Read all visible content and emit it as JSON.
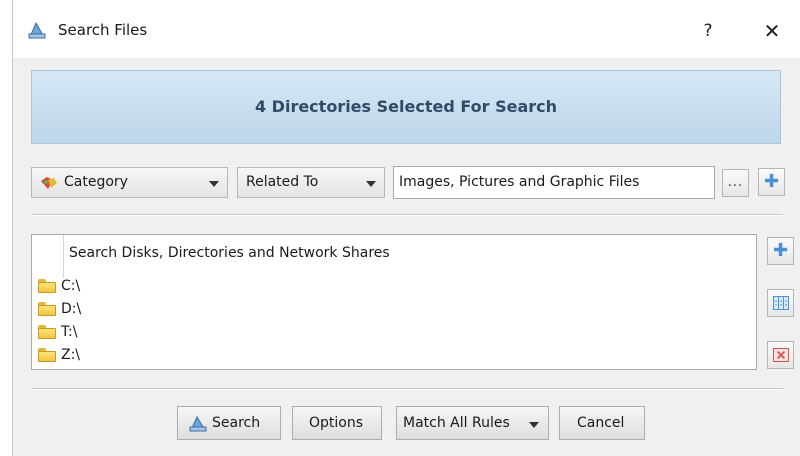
{
  "window": {
    "title": "Search Files",
    "help_label": "?",
    "close_label": "✕"
  },
  "banner": {
    "text": "4 Directories Selected For Search"
  },
  "rule": {
    "field_value": "Category",
    "field_icon": "category-icon",
    "operator_value": "Related To",
    "criteria_value": "Images, Pictures and Graphic Files",
    "browse_label": "...",
    "add_rule_icon": "plus-icon"
  },
  "locations": {
    "header": "Search Disks, Directories and Network Shares",
    "items": [
      {
        "label": "C:\\",
        "icon": "folder-icon"
      },
      {
        "label": "D:\\",
        "icon": "folder-icon"
      },
      {
        "label": "T:\\",
        "icon": "folder-icon"
      },
      {
        "label": "Z:\\",
        "icon": "folder-icon"
      }
    ],
    "side_buttons": [
      "add-location-icon",
      "edit-location-icon",
      "remove-location-icon"
    ]
  },
  "buttons": {
    "search": "Search",
    "options": "Options",
    "match": "Match All Rules",
    "cancel": "Cancel"
  },
  "colors": {
    "banner_bg": "#c8dff0",
    "banner_text": "#2f4b66",
    "accent_blue": "#4a90d9",
    "folder_yellow": "#f3c540",
    "remove_red": "#d9534f"
  }
}
